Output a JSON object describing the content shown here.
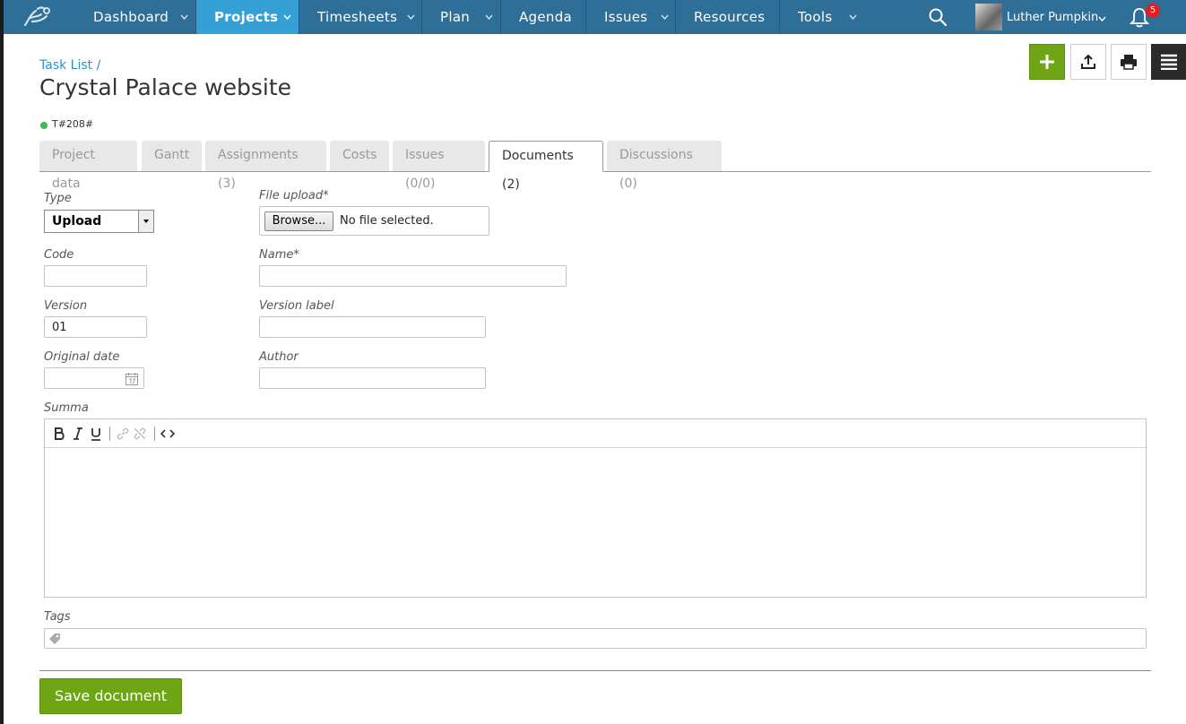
{
  "nav": {
    "items": [
      {
        "label": "Dashboard"
      },
      {
        "label": "Projects"
      },
      {
        "label": "Timesheets"
      },
      {
        "label": "Plan"
      },
      {
        "label": "Agenda"
      },
      {
        "label": "Issues"
      },
      {
        "label": "Resources"
      },
      {
        "label": "Tools"
      }
    ],
    "active": "Projects",
    "user": "Luther Pumpkin",
    "notifications": "5"
  },
  "header": {
    "breadcrumb": "Task List /",
    "title": "Crystal Palace website",
    "code": "T#208#",
    "status_color": "#3cba54"
  },
  "tabs": [
    {
      "label": "Project data"
    },
    {
      "label": "Gantt"
    },
    {
      "label": "Assignments (3)"
    },
    {
      "label": "Costs"
    },
    {
      "label": "Issues (0/0)"
    },
    {
      "label": "Documents (2)"
    },
    {
      "label": "Discussions (0)"
    }
  ],
  "form": {
    "type_label": "Type",
    "type_value": "Upload",
    "file_label": "File upload*",
    "browse_label": "Browse...",
    "no_file": "No file selected.",
    "code_label": "Code",
    "code_value": "",
    "name_label": "Name*",
    "name_value": "",
    "version_label": "Version",
    "version_value": "01",
    "version_label_label": "Version label",
    "version_label_value": "",
    "original_date_label": "Original date",
    "original_date_value": "",
    "author_label": "Author",
    "author_value": "",
    "summa_label": "Summa",
    "tags_label": "Tags",
    "save_label": "Save document"
  },
  "colors": {
    "nav_bg": "#2f6e96",
    "nav_active": "#35a0d6",
    "primary_green": "#6ea515",
    "link": "#2f8fc8"
  }
}
